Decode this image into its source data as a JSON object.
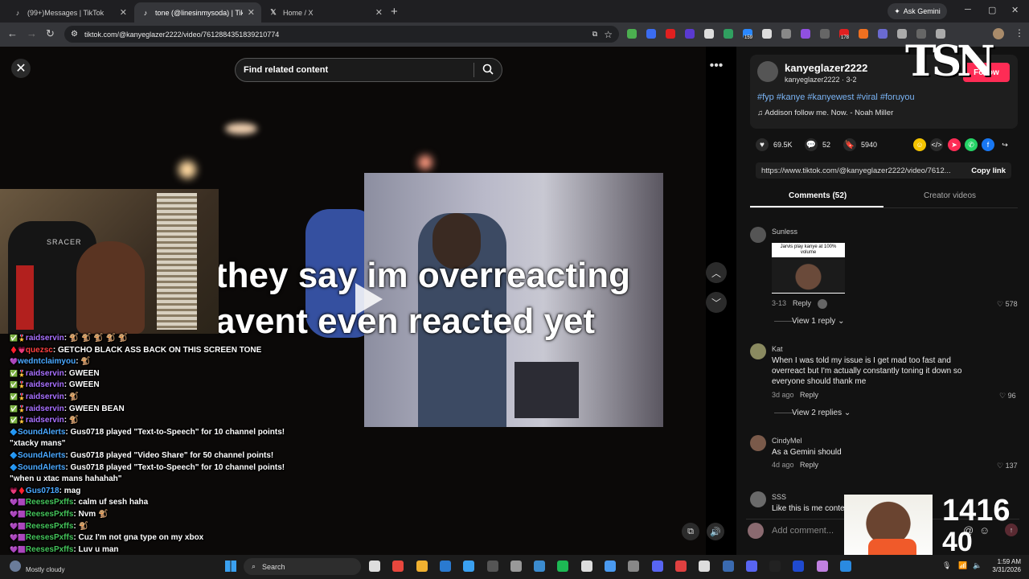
{
  "browser": {
    "tabs": [
      {
        "icon": "tiktok-icon",
        "title": "(99+)Messages | TikTok",
        "active": false
      },
      {
        "icon": "tiktok-icon",
        "title": "tone (@linesinmysoda) | TikTok",
        "active": true
      },
      {
        "icon": "x-logo-icon",
        "title": "Home / X",
        "active": false
      }
    ],
    "gemini_label": "Ask Gemini",
    "url": "tiktok.com/@kanyeglazer2222/video/7612884351839210774",
    "ext_badges": [
      "159",
      "178"
    ]
  },
  "video": {
    "search_placeholder": "Find related content",
    "caption_line1": "they say im overreacting",
    "caption_line2": "avent even reacted yet",
    "chair_brand": "SRACER"
  },
  "chat": [
    {
      "badges": "✅🎖️",
      "user": "raidservin",
      "color": "#a970ff",
      "msg": "🐒 🐒 🐒 🐒 🐒"
    },
    {
      "badges": "♦️💗",
      "user": "quezsc",
      "color": "#ff4040",
      "msg": "GETCHO BLACK ASS BACK ON THIS SCREEN TONE"
    },
    {
      "badges": "💜",
      "user": "wedntclaimyou",
      "color": "#4aa8ff",
      "msg": "🐒"
    },
    {
      "badges": "✅🎖️",
      "user": "raidservin",
      "color": "#a970ff",
      "msg": "GWEEN"
    },
    {
      "badges": "✅🎖️",
      "user": "raidservin",
      "color": "#a970ff",
      "msg": "GWEEN"
    },
    {
      "badges": "✅🎖️",
      "user": "raidservin",
      "color": "#a970ff",
      "msg": "🐒"
    },
    {
      "badges": "✅🎖️",
      "user": "raidservin",
      "color": "#a970ff",
      "msg": "GWEEN BEAN"
    },
    {
      "badges": "✅🎖️",
      "user": "raidservin",
      "color": "#a970ff",
      "msg": "🐒"
    },
    {
      "badges": "🔷",
      "user": "SoundAlerts",
      "color": "#4aa8ff",
      "msg": "Gus0718 played \"Text-to-Speech\" for 10 channel points!"
    },
    {
      "badges": "",
      "user": "",
      "color": "#fff",
      "msg": "\"xtacky mans\""
    },
    {
      "badges": "🔷",
      "user": "SoundAlerts",
      "color": "#4aa8ff",
      "msg": "Gus0718 played \"Video Share\" for 50 channel points!"
    },
    {
      "badges": "🔷",
      "user": "SoundAlerts",
      "color": "#4aa8ff",
      "msg": "Gus0718 played \"Text-to-Speech\" for 10 channel points!"
    },
    {
      "badges": "",
      "user": "",
      "color": "#fff",
      "msg": "\"when u xtac mans hahahah\""
    },
    {
      "badges": "💗♦️",
      "user": "Gus0718",
      "color": "#4aa8ff",
      "msg": "mag"
    },
    {
      "badges": "💜🟪",
      "user": "ReesesPxffs",
      "color": "#44c45a",
      "msg": "calm uf sesh haha"
    },
    {
      "badges": "💜🟪",
      "user": "ReesesPxffs",
      "color": "#44c45a",
      "msg": "Nvm 🐒"
    },
    {
      "badges": "💜🟪",
      "user": "ReesesPxffs",
      "color": "#44c45a",
      "msg": "🐒"
    },
    {
      "badges": "💜🟪",
      "user": "ReesesPxffs",
      "color": "#44c45a",
      "msg": "Cuz I'm not gna type on my xbox"
    },
    {
      "badges": "💜🟪",
      "user": "ReesesPxffs",
      "color": "#44c45a",
      "msg": "Luv u man"
    },
    {
      "badges": "💜🟪",
      "user": "ReesesPxffs",
      "color": "#44c45a",
      "msg": "🐒🐒🐒🐒"
    }
  ],
  "panel": {
    "username": "kanyeglazer2222",
    "subline": "kanyeglazer2222 · 3-2",
    "follow_label": "Follow",
    "hashtags": "#fyp #kanye #kanyewest #viral #foruyou",
    "music": "Addison follow me. Now. - Noah Miller",
    "likes": "69.5K",
    "comments": "52",
    "saves": "5940",
    "link": "https://www.tiktok.com/@kanyeglazer2222/video/7612...",
    "copy_link": "Copy link",
    "tab_comments": "Comments (52)",
    "tab_creator": "Creator videos",
    "watermark": "TSN",
    "add_comment": "Add comment...",
    "comment_list": [
      {
        "name": "Sunless",
        "text": "",
        "meme_text": "Jarvis play kanye at 100% volume",
        "date": "3-13",
        "reply": "Reply",
        "likes": "578",
        "view_replies": "View 1 reply"
      },
      {
        "name": "Kat",
        "text": "When I was told my issue is I get mad too fast and overreact but I'm actually constantly toning it down so everyone should thank me",
        "date": "3d ago",
        "reply": "Reply",
        "likes": "96",
        "view_replies": "View 2 replies"
      },
      {
        "name": "CindyMel",
        "text": "As a Gemini should",
        "date": "4d ago",
        "reply": "Reply",
        "likes": "137"
      },
      {
        "name": "SSS",
        "text": "Like this is me contemplating"
      }
    ]
  },
  "overlay": {
    "count1": "1416",
    "count2": "40"
  },
  "taskbar": {
    "weather": "Mostly cloudy",
    "search": "Search",
    "time": "1:59 AM",
    "date": "3/31/2026"
  }
}
